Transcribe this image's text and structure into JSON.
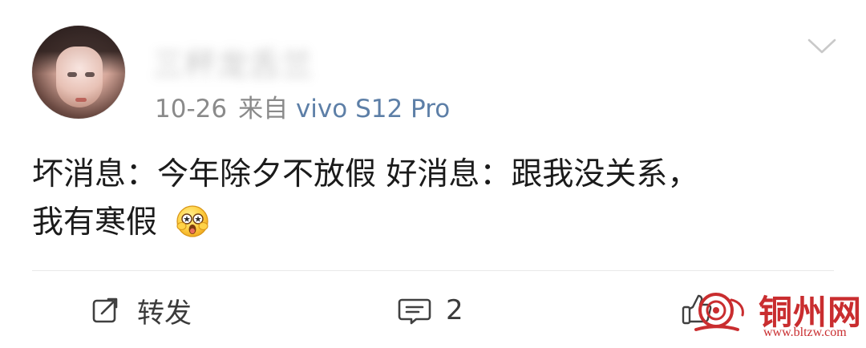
{
  "post": {
    "author": {
      "name": "三杯龙舌兰",
      "avatar": "profile-avatar"
    },
    "meta": {
      "date": "10-26",
      "source_prefix": "来自",
      "device": "vivo S12 Pro"
    },
    "content": {
      "line1": "坏消息：今年除夕不放假 好消息：跟我没关系，",
      "line2": "我有寒假",
      "emoji": "surprised-star-eyes-emoji"
    }
  },
  "actions": {
    "repost_label": "转发",
    "comment_count": "2",
    "like_label": ""
  },
  "watermark": {
    "title": "铜州网",
    "url": "www.bltzw.com",
    "color": "#c92d2f"
  },
  "colors": {
    "link": "#5d7fa7",
    "meta": "#8a8a8a",
    "text": "#1b1b1b",
    "divider": "#e9e9e9"
  },
  "icons": {
    "more": "chevron-down-icon",
    "repost": "share-edit-icon",
    "comment": "comment-bubble-icon",
    "like": "thumb-up-icon"
  }
}
